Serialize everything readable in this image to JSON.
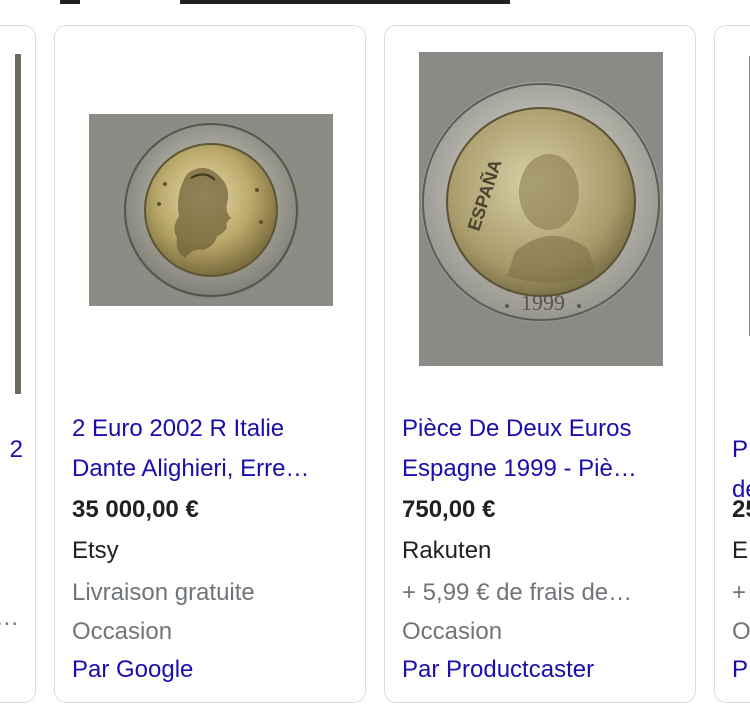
{
  "cards": [
    {
      "title_line1": "2 Euro 2002 R Italie",
      "title_line2": "Dante Alighieri, Erre…",
      "price": "35 000,00 €",
      "merchant": "Etsy",
      "shipping": "Livraison gratuite",
      "condition": "Occasion",
      "by": "Par Google",
      "image_icon": "italy-2-euro-coin-image"
    },
    {
      "title_line1": "Pièce De Deux Euros",
      "title_line2": "Espagne 1999 - Piè…",
      "price": "750,00 €",
      "merchant": "Rakuten",
      "shipping": "+ 5,99 € de frais de…",
      "condition": "Occasion",
      "by": "Par Productcaster",
      "image_icon": "spain-2-euro-coin-image",
      "coin_text": "ESPAÑA",
      "coin_year": "1999"
    }
  ],
  "left_partial_card": {
    "title_fragment": "2",
    "shipping_fragment": "…"
  },
  "right_partial_card": {
    "title_line1_fragment": "P",
    "title_line2_fragment": "de",
    "price_fragment": "25",
    "merchant_fragment": "E",
    "shipping_fragment": "+",
    "condition_fragment": "O",
    "by_fragment": "P"
  },
  "colors": {
    "link": "#1a0dab",
    "text": "#202124",
    "secondary": "#70757a",
    "border": "#dadce0"
  }
}
